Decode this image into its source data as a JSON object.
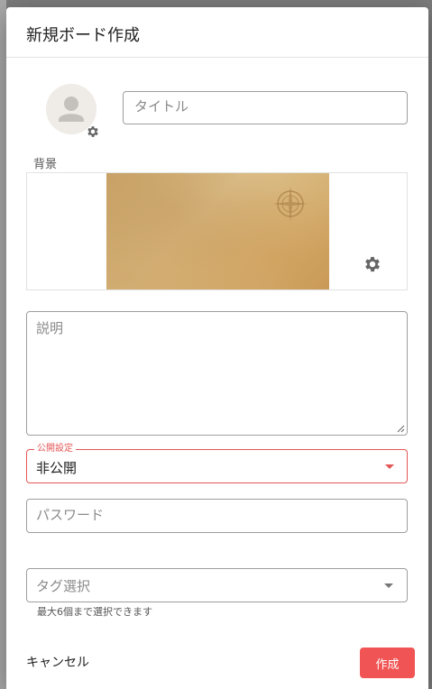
{
  "dialog": {
    "title": "新規ボード作成"
  },
  "form": {
    "title_placeholder": "タイトル",
    "background_label": "背景",
    "description_placeholder": "説明",
    "visibility": {
      "label": "公開設定",
      "value": "非公開"
    },
    "password_placeholder": "パスワード",
    "tags": {
      "placeholder": "タグ選択",
      "hint": "最大6個まで選択できます"
    }
  },
  "actions": {
    "cancel_label": "キャンセル",
    "create_label": "作成"
  },
  "colors": {
    "accent": "#f05454",
    "error_outline": "#e45757"
  },
  "icons": {
    "avatar": "account-circle-icon",
    "settings": "gear-icon",
    "dropdown": "caret-down-icon",
    "compass": "compass-rose-icon"
  }
}
